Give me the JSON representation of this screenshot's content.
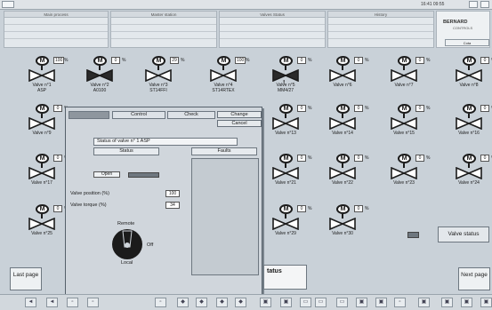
{
  "header": {
    "clock": "16:41 09:55",
    "panels": [
      "Main process",
      "Master station",
      "Valves Status",
      "History"
    ],
    "logo": "BERNARD",
    "logo_sub": "CONTROLS",
    "right_button": "Cota"
  },
  "valves": [
    {
      "label": "Valve n°1",
      "sub": "ASP",
      "pct": "100",
      "state": "open"
    },
    {
      "label": "Valve n°2",
      "sub": "A0100",
      "pct": "0",
      "state": "closed"
    },
    {
      "label": "Valve n°3",
      "sub": "ST14FFI",
      "pct": "29",
      "state": "open"
    },
    {
      "label": "Valve n°4",
      "sub": "ST14RTEX",
      "pct": "100",
      "state": "open"
    },
    {
      "label": "Valve n°5",
      "sub": "MM4/27",
      "pct": "0",
      "state": "closed",
      "warn": "!"
    },
    {
      "label": "Valve n°6",
      "sub": "",
      "pct": "0",
      "state": "open"
    },
    {
      "label": "Valve n°7",
      "sub": "",
      "pct": "0",
      "state": "open"
    },
    {
      "label": "Valve n°8",
      "sub": "",
      "pct": "0",
      "state": "open"
    },
    {
      "label": "Valve n°9",
      "sub": "",
      "pct": "0",
      "state": "open"
    },
    {
      "label": "Valve n°13",
      "sub": "",
      "pct": "0",
      "state": "open"
    },
    {
      "label": "Valve n°14",
      "sub": "",
      "pct": "0",
      "state": "open"
    },
    {
      "label": "Valve n°15",
      "sub": "",
      "pct": "0",
      "state": "open"
    },
    {
      "label": "Valve n°16",
      "sub": "",
      "pct": "0",
      "state": "open"
    },
    {
      "label": "Valve n°17",
      "sub": "",
      "pct": "0",
      "state": "open"
    },
    {
      "label": "Valve n°21",
      "sub": "",
      "pct": "0",
      "state": "open"
    },
    {
      "label": "Valve n°22",
      "sub": "",
      "pct": "0",
      "state": "open"
    },
    {
      "label": "Valve n°23",
      "sub": "",
      "pct": "0",
      "state": "open"
    },
    {
      "label": "Valve n°24",
      "sub": "",
      "pct": "0",
      "state": "open"
    },
    {
      "label": "Valve n°25",
      "sub": "",
      "pct": "0",
      "state": "open"
    },
    {
      "label": "Valve n°29",
      "sub": "",
      "pct": "0",
      "state": "open"
    },
    {
      "label": "Valve n°30",
      "sub": "",
      "pct": "0",
      "state": "open"
    }
  ],
  "dialog": {
    "tabs": [
      "Control",
      "Check"
    ],
    "change": "Change",
    "cancel": "Cancel",
    "status_title": "Status of valve n°    1    ASP",
    "status_col": "Status",
    "faults_col": "Faults",
    "open_label": "Open",
    "valve_position_label": "Valve position (%)",
    "valve_position": "100",
    "valve_torque_label": "Valve torque (%)",
    "valve_torque": "34",
    "remote": "Remote",
    "off": "Off",
    "local": "Local"
  },
  "right": {
    "valve_status_button": "Valve status",
    "status_text": "tatus"
  },
  "nav": {
    "last_page": "Last page",
    "next_page": "Next page"
  }
}
